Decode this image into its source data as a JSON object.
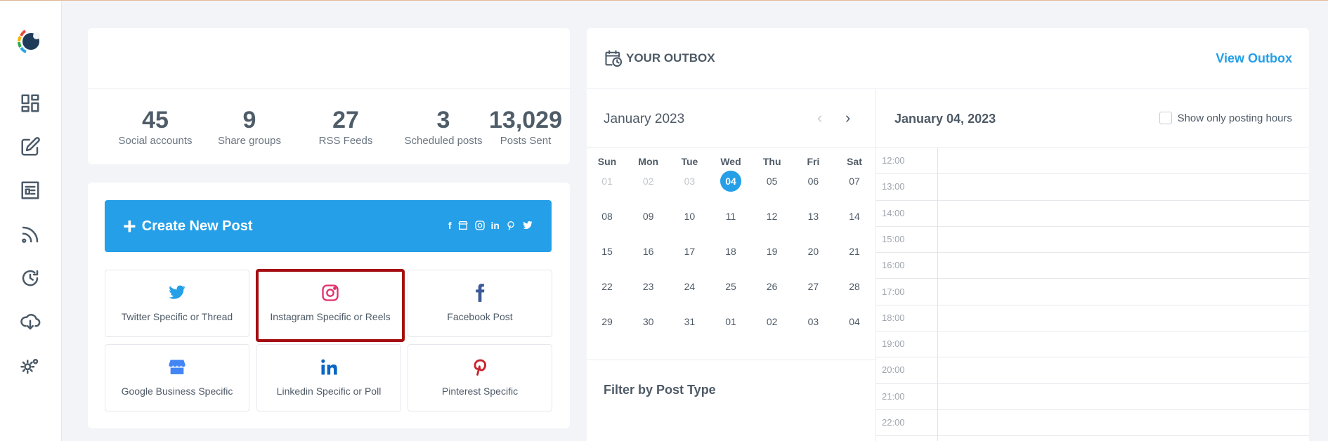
{
  "sidebar": {
    "icons": [
      "dashboard-icon",
      "edit-icon",
      "article-icon",
      "rss-icon",
      "schedule-icon",
      "cloud-download-icon",
      "settings-icon"
    ]
  },
  "stats": [
    {
      "value": "45",
      "label": "Social accounts"
    },
    {
      "value": "9",
      "label": "Share groups"
    },
    {
      "value": "27",
      "label": "RSS Feeds"
    },
    {
      "value": "3",
      "label": "Scheduled posts"
    },
    {
      "value": "13,029",
      "label": "Posts Sent"
    }
  ],
  "create": {
    "plus": "+",
    "label": "Create New Post",
    "mini_icons": [
      "f",
      "in"
    ]
  },
  "tiles": [
    {
      "label": "Twitter Specific or Thread",
      "icon": "twitter-icon",
      "color": "#249fe8"
    },
    {
      "label": "Instagram Specific or Reels",
      "icon": "instagram-icon",
      "color": "#e1306c"
    },
    {
      "label": "Facebook Post",
      "icon": "facebook-icon",
      "color": "#3b5998"
    },
    {
      "label": "Google Business Specific",
      "icon": "google-business-icon",
      "color": "#4285f4"
    },
    {
      "label": "Linkedin Specific or Poll",
      "icon": "linkedin-icon",
      "color": "#0a66c2"
    },
    {
      "label": "Pinterest Specific",
      "icon": "pinterest-icon",
      "color": "#c8232c"
    }
  ],
  "outbox": {
    "title": "YOUR OUTBOX",
    "view_link": "View Outbox"
  },
  "calendar": {
    "month": "January 2023",
    "prev": "‹",
    "next": "›",
    "dow": [
      "Sun",
      "Mon",
      "Tue",
      "Wed",
      "Thu",
      "Fri",
      "Sat"
    ],
    "weeks": [
      [
        "01",
        "02",
        "03",
        "04",
        "05",
        "06",
        "07"
      ],
      [
        "08",
        "09",
        "10",
        "11",
        "12",
        "13",
        "14"
      ],
      [
        "15",
        "16",
        "17",
        "18",
        "19",
        "20",
        "21"
      ],
      [
        "22",
        "23",
        "24",
        "25",
        "26",
        "27",
        "28"
      ],
      [
        "29",
        "30",
        "31",
        "01",
        "02",
        "03",
        "04"
      ]
    ],
    "selected_day": "04",
    "filter_title": "Filter by Post Type"
  },
  "day_view": {
    "title": "January 04, 2023",
    "toggle_label": "Show only posting hours",
    "times": [
      "12:00",
      "13:00",
      "14:00",
      "15:00",
      "16:00",
      "17:00",
      "18:00",
      "19:00",
      "20:00",
      "21:00",
      "22:00"
    ]
  },
  "colors": {
    "accent": "#249fe8",
    "highlight_border": "#a50d12"
  }
}
